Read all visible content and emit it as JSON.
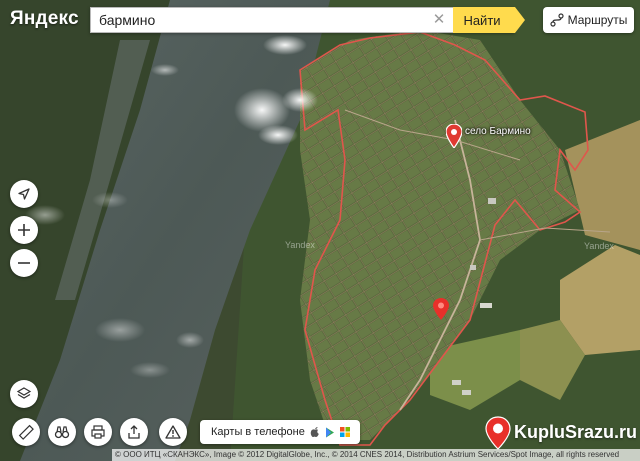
{
  "logo": "Яндекс",
  "search": {
    "value": "бармино",
    "button_label": "Найти"
  },
  "routes": {
    "label": "Маршруты"
  },
  "pin": {
    "label": "село Бармино"
  },
  "watermarks": [
    "Yandex",
    "Yandex"
  ],
  "phone_banner": {
    "label": "Карты в телефоне"
  },
  "copyright": "© ООО ИТЦ «СКАНЭКС», Image © 2012 DigitalGlobe, Inc., © 2014 CNES 2014, Distribution Astrium Services/Spot Image, all rights reserved",
  "brand": {
    "text": "KupluSrazu.ru"
  },
  "icons": {
    "clear": "close-icon",
    "routes": "route-icon",
    "locate": "location-arrow-icon",
    "zoom_in": "plus-icon",
    "zoom_out": "minus-icon",
    "layers": "layers-icon",
    "ruler": "ruler-icon",
    "panorama": "binoculars-icon",
    "print": "printer-icon",
    "share": "share-icon",
    "report": "warning-icon",
    "apple": "apple-icon",
    "google_play": "google-play-icon",
    "windows": "windows-icon",
    "pin": "map-pin-icon"
  },
  "colors": {
    "accent": "#ffdb4d",
    "boundary": "#e0564c",
    "pin": "#e03a32",
    "brand": "#e8302a"
  }
}
